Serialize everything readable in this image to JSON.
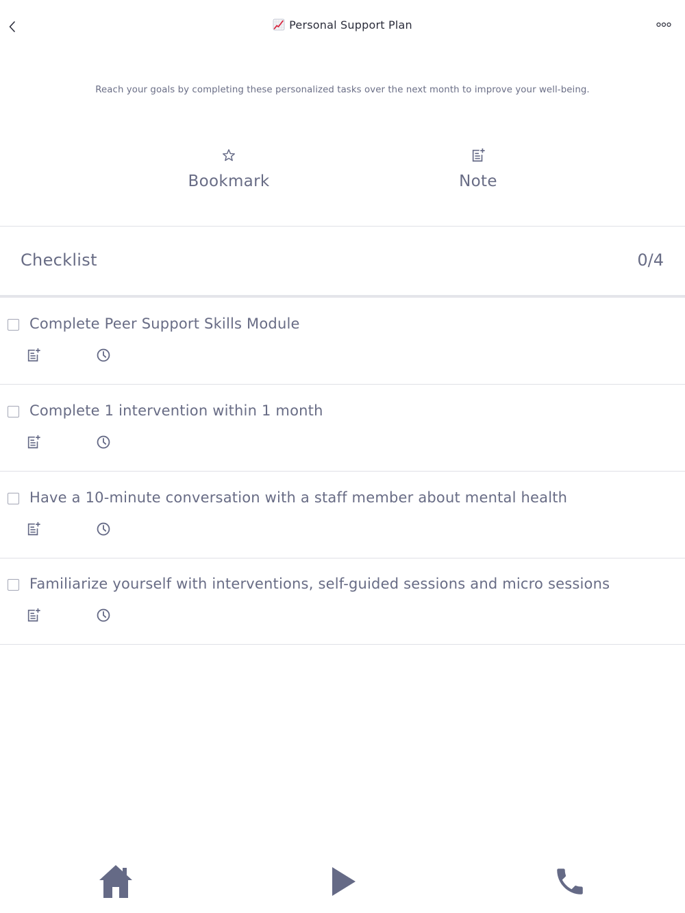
{
  "header": {
    "title": "Personal Support Plan",
    "title_icon": "chart-increasing-emoji",
    "back_icon": "chevron-left-icon",
    "more_icon": "more-dots-icon"
  },
  "subtitle": "Reach your goals by completing these personalized tasks over the next month to improve your well-being.",
  "actions": {
    "bookmark_label": "Bookmark",
    "bookmark_icon": "star-outline-icon",
    "note_label": "Note",
    "note_icon": "note-add-icon"
  },
  "checklist": {
    "title": "Checklist",
    "count": "0/4",
    "tasks": [
      {
        "label": "Complete Peer Support Skills Module",
        "checked": false
      },
      {
        "label": "Complete 1 intervention within 1 month",
        "checked": false
      },
      {
        "label": "Have a 10-minute conversation with a staff member about mental health",
        "checked": false
      },
      {
        "label": "Familiarize yourself with interventions, self-guided sessions and micro sessions",
        "checked": false
      }
    ]
  },
  "bottom_nav": {
    "items": [
      "home-icon",
      "play-icon",
      "phone-icon"
    ]
  },
  "colors": {
    "text_primary": "#686c85",
    "title_text": "#2a2c3a",
    "icon": "#656a86",
    "divider": "#dfe0e6",
    "background": "#ffffff"
  }
}
